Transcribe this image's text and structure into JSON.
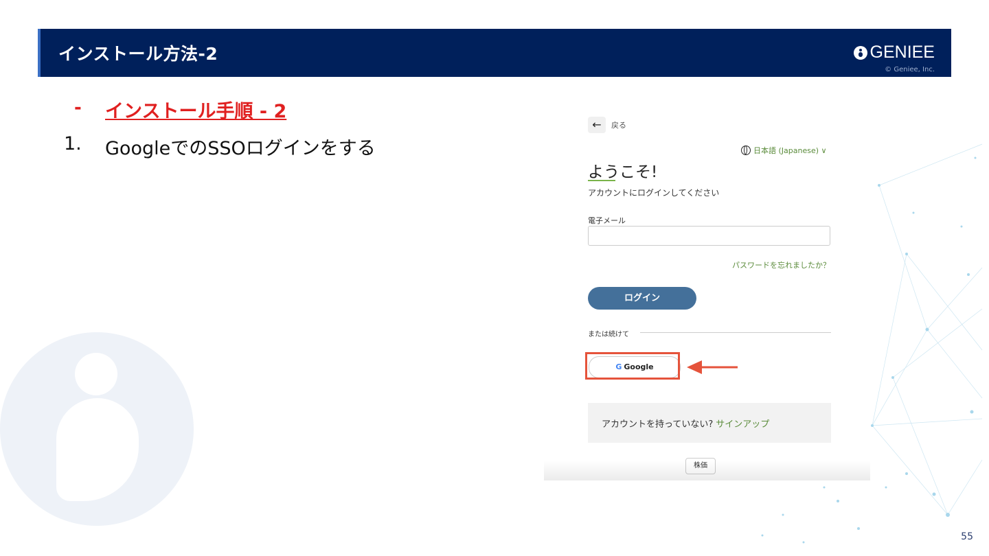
{
  "header": {
    "title": "インストール方法-2",
    "logo_text": "GENIEE",
    "copyright": "© Geniee, Inc."
  },
  "content": {
    "bullet_dash": "-",
    "bullet_text": "インストール手順 - 2",
    "step_number": "1.",
    "step_text": "GoogleでのSSOログインをする"
  },
  "login_screen": {
    "back_icon": "arrow-left-icon",
    "back_label": "戻る",
    "language_icon": "globe-icon",
    "language": "日本語 (Japanese) ∨",
    "welcome": "ようこそ!",
    "subtitle": "アカウントにログインしてください",
    "email_label": "電子メール",
    "email_value": "",
    "forgot_password": "パスワードを忘れましたか？",
    "login_button": "ログイン",
    "or_continue": "または続けて",
    "google_button": "Google",
    "google_icon": "G",
    "signup_prompt": "アカウントを持っていない?",
    "signup_link": "サインアップ",
    "tooltip": "株価"
  },
  "annotation": {
    "highlight_color": "#e5533b"
  },
  "page_number": "55"
}
